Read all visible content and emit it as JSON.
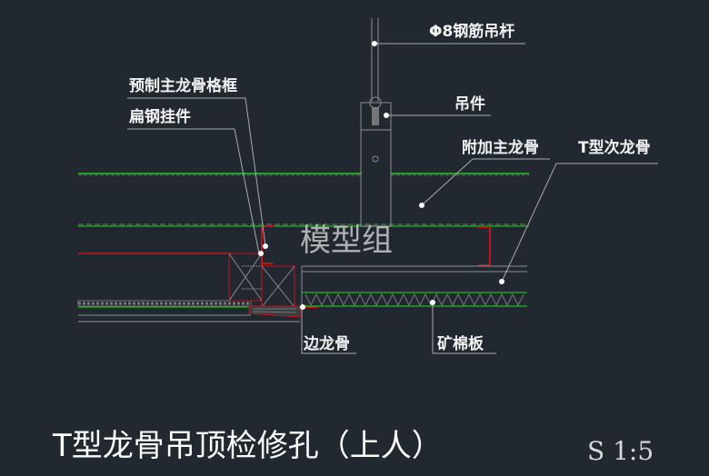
{
  "drawing": {
    "title": "T型龙骨吊顶检修孔（上人）",
    "scale": "S 1:5",
    "watermark": "模型组",
    "labels": {
      "steel_rod": "Φ8钢筋吊杆",
      "hanger": "吊件",
      "prefab_frame": "预制主龙骨格框",
      "flat_steel_hook": "扁钢挂件",
      "extra_main_keel": "附加主龙骨",
      "t_secondary_keel": "T型次龙骨",
      "edge_keel": "边龙骨",
      "mineral_wool_board": "矿棉板"
    },
    "colors": {
      "background": "#212830",
      "green_line": "#1fa51f",
      "red_line": "#c0151e",
      "gray_line": "#8a8d92",
      "label_text": "#f2f2f2"
    }
  }
}
